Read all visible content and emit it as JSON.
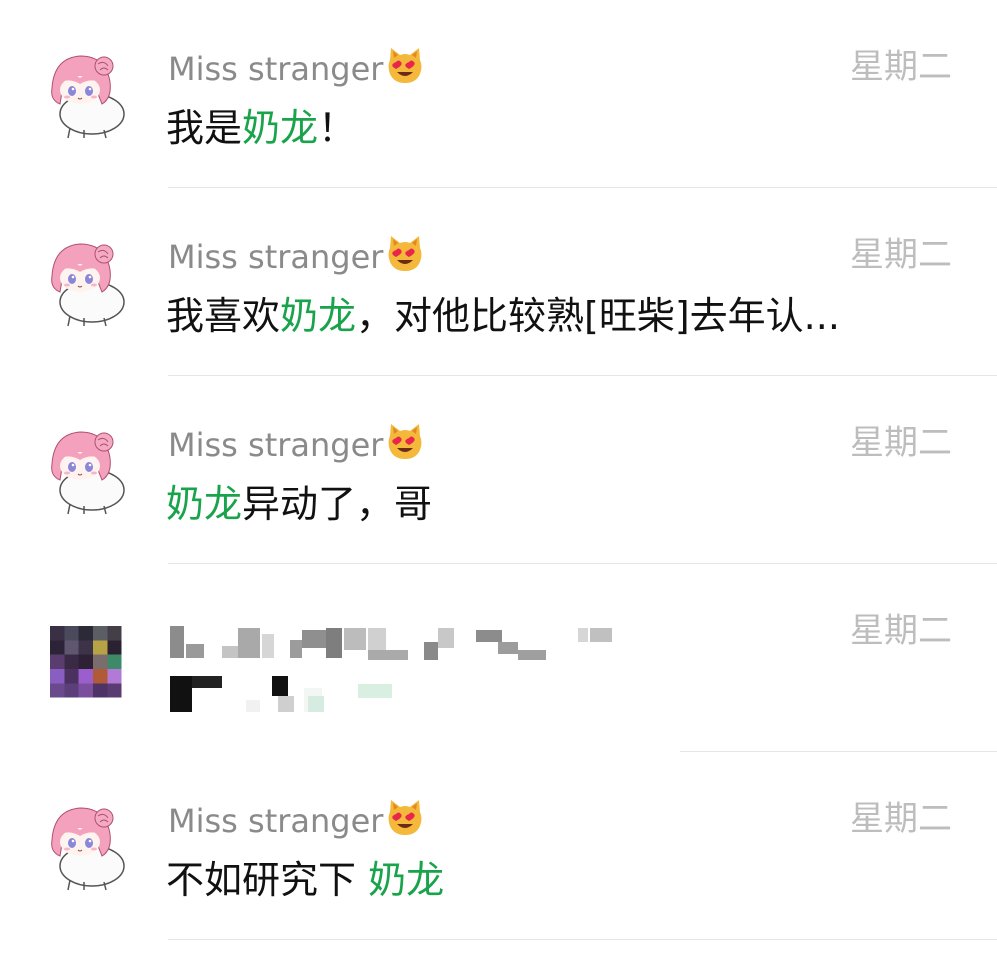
{
  "chats": [
    {
      "name": "Miss stranger",
      "name_emoji": "smiling-cat-heart-eyes-emoji",
      "date": "星期二",
      "preview": [
        {
          "text": "我是",
          "highlight": false
        },
        {
          "text": "奶龙",
          "highlight": true
        },
        {
          "text": "！",
          "highlight": false
        }
      ]
    },
    {
      "name": "Miss stranger",
      "name_emoji": "smiling-cat-heart-eyes-emoji",
      "date": "星期二",
      "preview": [
        {
          "text": "我喜欢",
          "highlight": false
        },
        {
          "text": "奶龙",
          "highlight": true
        },
        {
          "text": "，对他比较熟[旺柴]去年认...",
          "highlight": false
        }
      ]
    },
    {
      "name": "Miss stranger",
      "name_emoji": "smiling-cat-heart-eyes-emoji",
      "date": "星期二",
      "preview": [
        {
          "text": "奶龙",
          "highlight": true
        },
        {
          "text": "异动了，哥",
          "highlight": false
        }
      ]
    },
    {
      "name": "",
      "date": "星期二",
      "redacted": true,
      "preview": []
    },
    {
      "name": "Miss stranger",
      "name_emoji": "smiling-cat-heart-eyes-emoji",
      "date": "星期二",
      "preview": [
        {
          "text": "不如研究下 ",
          "highlight": false
        },
        {
          "text": "奶龙",
          "highlight": true
        }
      ]
    }
  ],
  "colors": {
    "highlight": "#19a34a",
    "name": "#8a8a8a",
    "date": "#bdbdbd",
    "text": "#111111",
    "divider": "#e6e6e6"
  }
}
